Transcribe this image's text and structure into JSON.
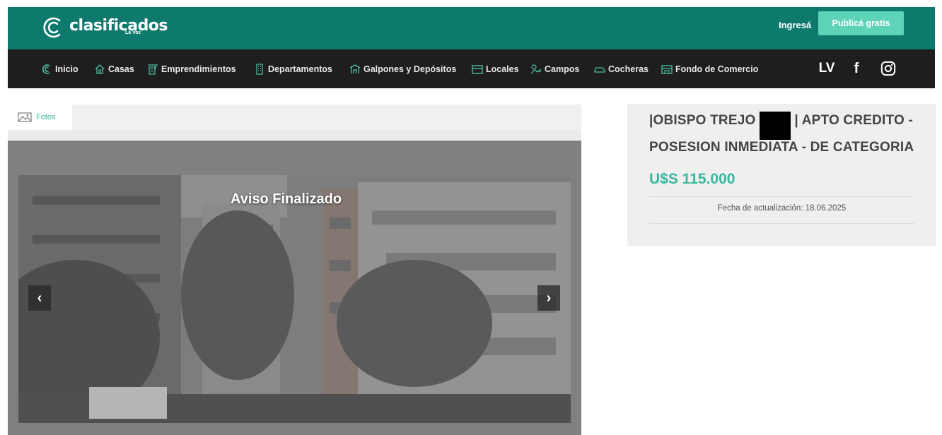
{
  "header": {
    "logo_text": "clasificados",
    "logo_sub": "La Voz",
    "login": "Ingresá",
    "publish": "Publicá gratis"
  },
  "nav": {
    "items": [
      {
        "label": "Inicio",
        "icon": "logo-c-icon"
      },
      {
        "label": "Casas",
        "icon": "house-icon"
      },
      {
        "label": "Emprendimientos",
        "icon": "building-crane-icon"
      },
      {
        "label": "Departamentos",
        "icon": "apartment-building-icon"
      },
      {
        "label": "Galpones y Depósitos",
        "icon": "warehouse-icon"
      },
      {
        "label": "Locales",
        "icon": "storefront-icon"
      },
      {
        "label": "Campos",
        "icon": "field-icon"
      },
      {
        "label": "Cocheras",
        "icon": "car-icon"
      },
      {
        "label": "Fondo de Comercio",
        "icon": "shop-icon"
      }
    ],
    "social": {
      "lv": "LV",
      "facebook": "f"
    }
  },
  "gallery": {
    "tab_label": "Fotos",
    "status_overlay": "Aviso Finalizado",
    "prev": "‹",
    "next": "›"
  },
  "listing": {
    "title_part1": "|OBISPO TREJO",
    "title_part2": "| APTO CREDITO - POSESION INMEDIATA - DE CATEGORIA",
    "price": "U$S 115.000",
    "updated": "Fecha de actualización: 18.06.2025"
  },
  "colors": {
    "header_bg": "#0e7a6e",
    "nav_bg": "#1e1e1e",
    "accent": "#5dd3b8",
    "price": "#3bb89e"
  }
}
